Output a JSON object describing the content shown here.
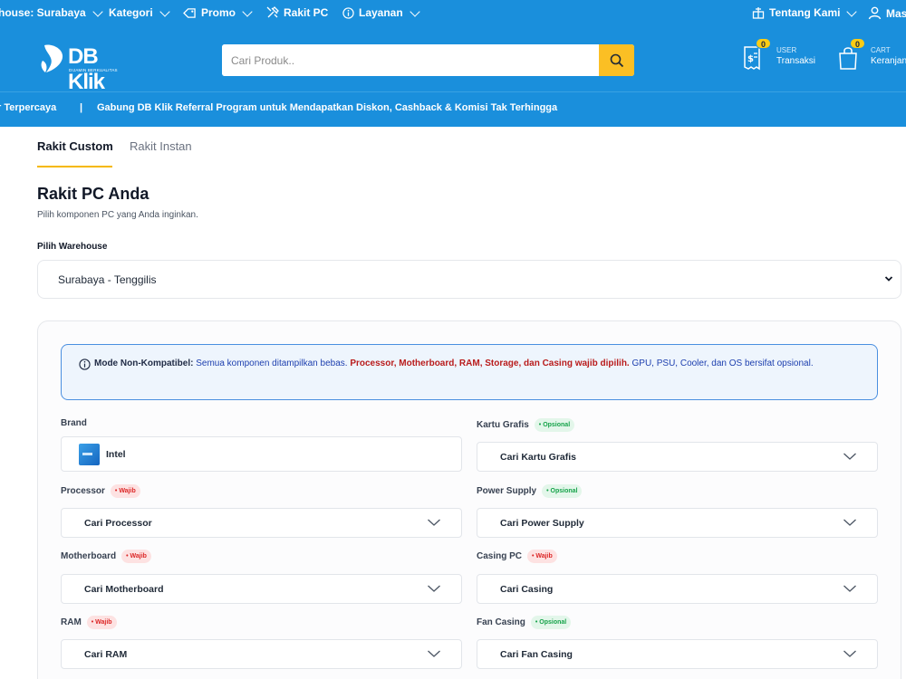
{
  "topbar": {
    "warehouse": "house: Surabaya",
    "kategori": "Kategori",
    "promo": "Promo",
    "rakit": "Rakit PC",
    "layanan": "Layanan",
    "tentang": "Tentang Kami",
    "masuk": "Mas"
  },
  "header": {
    "logo_text": "DB Klik",
    "logo_tagline": "DIJAMIN BERKUALITAS",
    "search_placeholder": "Cari Produk..",
    "user_badge": "0",
    "user_small": "USER",
    "user_label": "Transaksi",
    "cart_badge": "0",
    "cart_small": "CART",
    "cart_label": "Keranjan"
  },
  "marquee": {
    "left_text": "r Terpercaya",
    "separator": "|",
    "main_text": "Gabung DB Klik Referral Program untuk Mendapatkan Diskon, Cashback & Komisi Tak Terhingga"
  },
  "tabs": {
    "custom": "Rakit Custom",
    "instan": "Rakit Instan"
  },
  "page": {
    "title": "Rakit PC Anda",
    "subtitle": "Pilih komponen PC yang Anda inginkan.",
    "warehouse_label": "Pilih Warehouse",
    "warehouse_value": "Surabaya - Tenggilis"
  },
  "notice": {
    "lead": "Mode Non-Kompatibel:",
    "text1": " Semua komponen ditampilkan bebas. ",
    "required": "Processor, Motherboard, RAM, Storage, dan Casing wajib dipilih.",
    "text2": " GPU, PSU, Cooler, dan OS bersifat opsional."
  },
  "fields": {
    "brand": {
      "label": "Brand",
      "value": "Intel"
    },
    "processor": {
      "label": "Processor",
      "tag": "• Wajib",
      "placeholder": "Cari Processor"
    },
    "motherboard": {
      "label": "Motherboard",
      "tag": "• Wajib",
      "placeholder": "Cari Motherboard"
    },
    "ram": {
      "label": "RAM",
      "tag": "• Wajib",
      "placeholder": "Cari RAM"
    },
    "gpu": {
      "label": "Kartu Grafis",
      "tag": "• Opsional",
      "placeholder": "Cari Kartu Grafis"
    },
    "psu": {
      "label": "Power Supply",
      "tag": "• Opsional",
      "placeholder": "Cari Power Supply"
    },
    "casing": {
      "label": "Casing PC",
      "tag": "• Wajib",
      "placeholder": "Cari Casing"
    },
    "fan": {
      "label": "Fan Casing",
      "tag": "• Opsional",
      "placeholder": "Cari Fan Casing"
    }
  },
  "colors": {
    "brand_blue": "#1a8fdc",
    "accent_yellow": "#fbbf24",
    "required_red": "#dc2626",
    "optional_green": "#16a34a"
  }
}
